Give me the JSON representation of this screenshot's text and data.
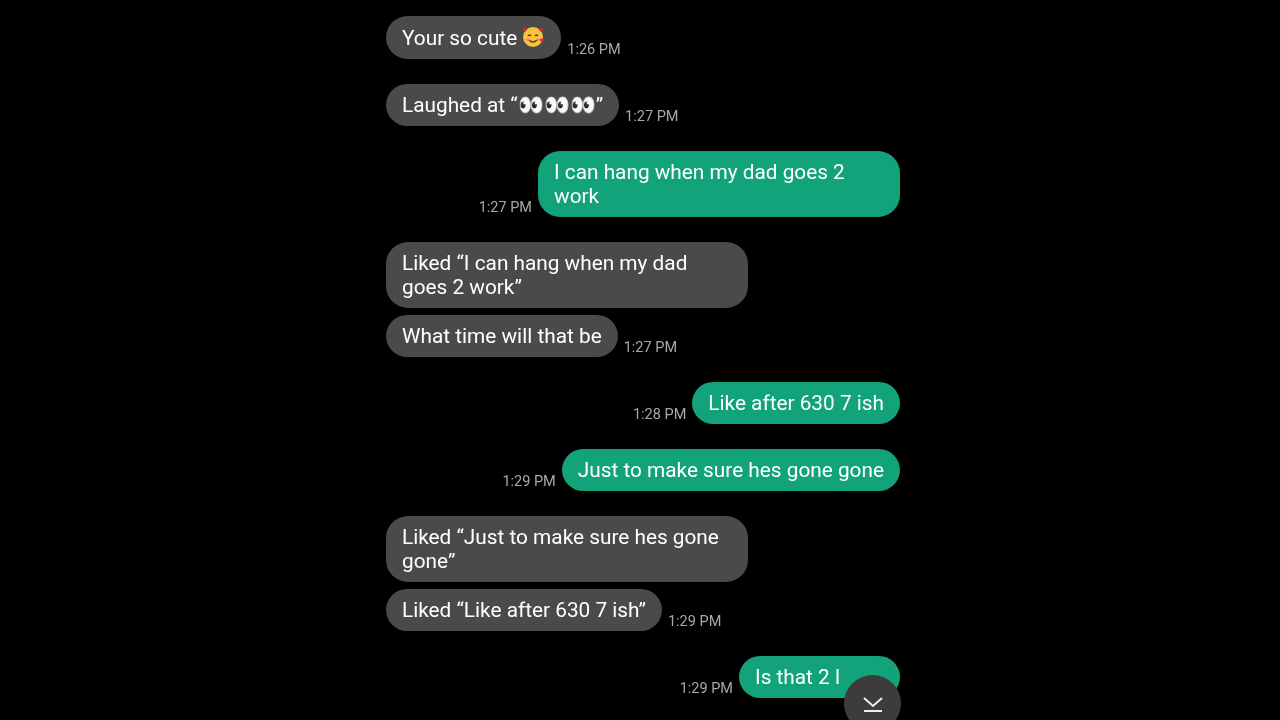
{
  "groups": [
    {
      "sent": false,
      "time": "1:26 PM",
      "messages": [
        {
          "kind": "emoji",
          "text": "Your so cute"
        }
      ]
    },
    {
      "sent": false,
      "time": "1:27 PM",
      "messages": [
        {
          "kind": "text",
          "text": "Laughed at “👀👀👀”"
        }
      ]
    },
    {
      "sent": true,
      "time": "1:27 PM",
      "messages": [
        {
          "kind": "text",
          "text": "I can hang when my dad goes 2 work"
        }
      ]
    },
    {
      "sent": false,
      "time": "1:27 PM",
      "messages": [
        {
          "kind": "text",
          "text": "Liked “I can hang when my dad goes 2 work”"
        },
        {
          "kind": "text",
          "text": "What time will that be"
        }
      ]
    },
    {
      "sent": true,
      "time": "1:28 PM",
      "messages": [
        {
          "kind": "text",
          "text": "Like after 630 7 ish"
        }
      ]
    },
    {
      "sent": true,
      "time": "1:29 PM",
      "messages": [
        {
          "kind": "text",
          "text": "Just to make sure hes gone gone"
        }
      ]
    },
    {
      "sent": false,
      "time": "1:29 PM",
      "messages": [
        {
          "kind": "text",
          "text": "Liked “Just to make sure hes gone gone”"
        },
        {
          "kind": "text",
          "text": "Liked “Like after 630 7 ish”"
        }
      ]
    },
    {
      "sent": true,
      "time": "1:29 PM",
      "messages": [
        {
          "kind": "covered",
          "text": "Is that 2 l"
        }
      ]
    }
  ]
}
